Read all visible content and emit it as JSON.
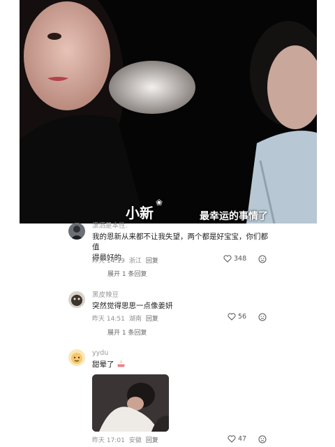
{
  "video": {
    "caption_name": "小新",
    "caption_flower": "❀",
    "caption_text": "最幸运的事情了"
  },
  "comments": [
    {
      "username": "潇洒是本性.",
      "text_lines": [
        "我的恩新从来都不让我失望，两个都是好宝宝，你们都值",
        "得最好的"
      ],
      "time": "昨天 14:19",
      "location": "浙江",
      "reply": "回复",
      "likes": "348",
      "expand": "展开 1 条回复"
    },
    {
      "username": "黑皮辣豆",
      "text_lines": [
        "突然觉得思思一点像姜妍"
      ],
      "time": "昨天 14:51",
      "location": "湖南",
      "reply": "回复",
      "likes": "56",
      "expand": "展开 1 条回复"
    },
    {
      "username": "yydu",
      "text_lines": [
        "甜晕了"
      ],
      "emoji": "cake-emoji",
      "time": "昨天 17:01",
      "location": "安徽",
      "reply": "回复",
      "likes": "47"
    }
  ],
  "icons": {
    "like": "heart-outline-icon",
    "dislike": "sad-face-icon"
  },
  "colors": {
    "meta_gray": "#8f8f8f",
    "video_bg": "#050505"
  }
}
